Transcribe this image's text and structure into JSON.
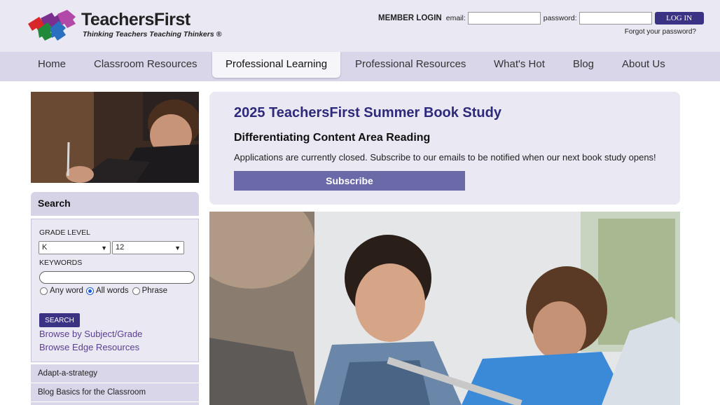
{
  "header": {
    "logo_text": "TeachersFirst",
    "logo_tagline": "Thinking Teachers Teaching Thinkers ®",
    "member_login_label": "MEMBER LOGIN",
    "email_label": "email:",
    "password_label": "password:",
    "login_button": "LOG IN",
    "forgot_password": "Forgot your password?"
  },
  "nav": {
    "items": [
      {
        "label": "Home"
      },
      {
        "label": "Classroom Resources"
      },
      {
        "label": "Professional Learning"
      },
      {
        "label": "Professional Resources"
      },
      {
        "label": "What's Hot"
      },
      {
        "label": "Blog"
      },
      {
        "label": "About Us"
      }
    ],
    "active": "Professional Learning"
  },
  "search": {
    "title": "Search",
    "grade_level_label": "GRADE LEVEL",
    "grade_from": "K",
    "grade_to": "12",
    "keywords_label": "KEYWORDS",
    "keywords_value": "",
    "match_options": [
      "Any word",
      "All words",
      "Phrase"
    ],
    "match_selected": "All words",
    "search_button": "SEARCH",
    "browse_links": [
      "Browse by Subject/Grade",
      "Browse Edge Resources"
    ]
  },
  "sidebar": {
    "items": [
      "Adapt-a-strategy",
      "Blog Basics for the Classroom"
    ]
  },
  "book_study": {
    "title": "2025 TeachersFirst Summer Book Study",
    "subtitle": "Differentiating Content Area Reading",
    "description": "Applications are currently closed. Subscribe to our emails to be notified when our next book study opens!",
    "button": "Subscribe"
  },
  "colors": {
    "brand_purple": "#3a3282",
    "header_bg": "#e9e8f3",
    "nav_bg": "#d9d6ea",
    "title_color": "#2e2a7a",
    "subscribe_bg": "#6a6aa8",
    "link_color": "#5b3f8e"
  }
}
